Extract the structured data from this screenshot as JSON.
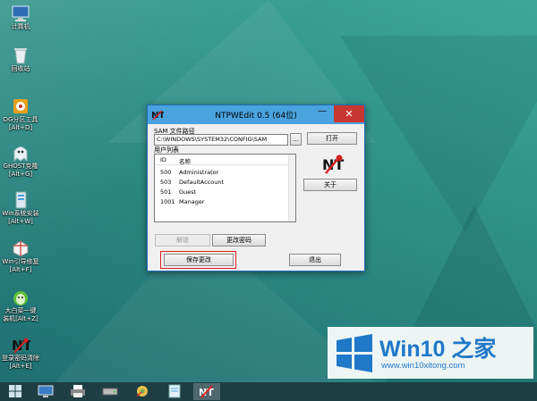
{
  "desktop": {
    "icons": [
      {
        "label": "计算机",
        "icon": "computer-icon"
      },
      {
        "label": "回收站",
        "icon": "recycle-bin-icon"
      },
      {
        "label": "DG分区工具",
        "label2": "[Alt+D]",
        "icon": "disk-tool-icon"
      },
      {
        "label": "GHOST克隆",
        "label2": "[Alt+G]",
        "icon": "ghost-icon"
      },
      {
        "label": "Win系统安装",
        "label2": "[Alt+W]",
        "icon": "win-install-icon"
      },
      {
        "label": "Win引导修复",
        "label2": "[Alt+F]",
        "icon": "boot-repair-icon"
      },
      {
        "label": "大白菜一键",
        "label2": "装机[Alt+Z]",
        "icon": "one-key-install-icon"
      },
      {
        "label": "登录密码清除",
        "label2": "[Alt+E]",
        "icon": "password-clear-icon"
      }
    ]
  },
  "window": {
    "title": "NTPWEdit 0.5 (64位)",
    "minimize": "—",
    "close": "✕",
    "sam_label": "SAM 文件路径",
    "sam_path": "C:\\WINDOWS\\SYSTEM32\\CONFIG\\SAM",
    "browse": "...",
    "open": "打开",
    "users_label": "用户列表",
    "columns": [
      "ID",
      "名称"
    ],
    "users": [
      {
        "id": "500",
        "name": "Administrator"
      },
      {
        "id": "503",
        "name": "DefaultAccount"
      },
      {
        "id": "501",
        "name": "Guest"
      },
      {
        "id": "1001",
        "name": "Manager"
      }
    ],
    "unlock": "解锁",
    "change_password": "更改密码",
    "about": "关于",
    "save": "保存更改",
    "exit": "退出",
    "logo_text": "NT"
  },
  "watermark": {
    "brand": "Win10 之家",
    "url": "www.win10xitong.com"
  },
  "taskbar": {
    "items": [
      "start-icon",
      "display-icon",
      "printer-icon",
      "drive-icon",
      "tools-icon",
      "notepad-icon",
      "ntpwedit-icon"
    ],
    "active_index": 6
  },
  "colors": {
    "title_bar": "#4aa3df",
    "close_button": "#c7372f",
    "highlight": "#e02020",
    "brand_blue": "#1f78c8"
  }
}
